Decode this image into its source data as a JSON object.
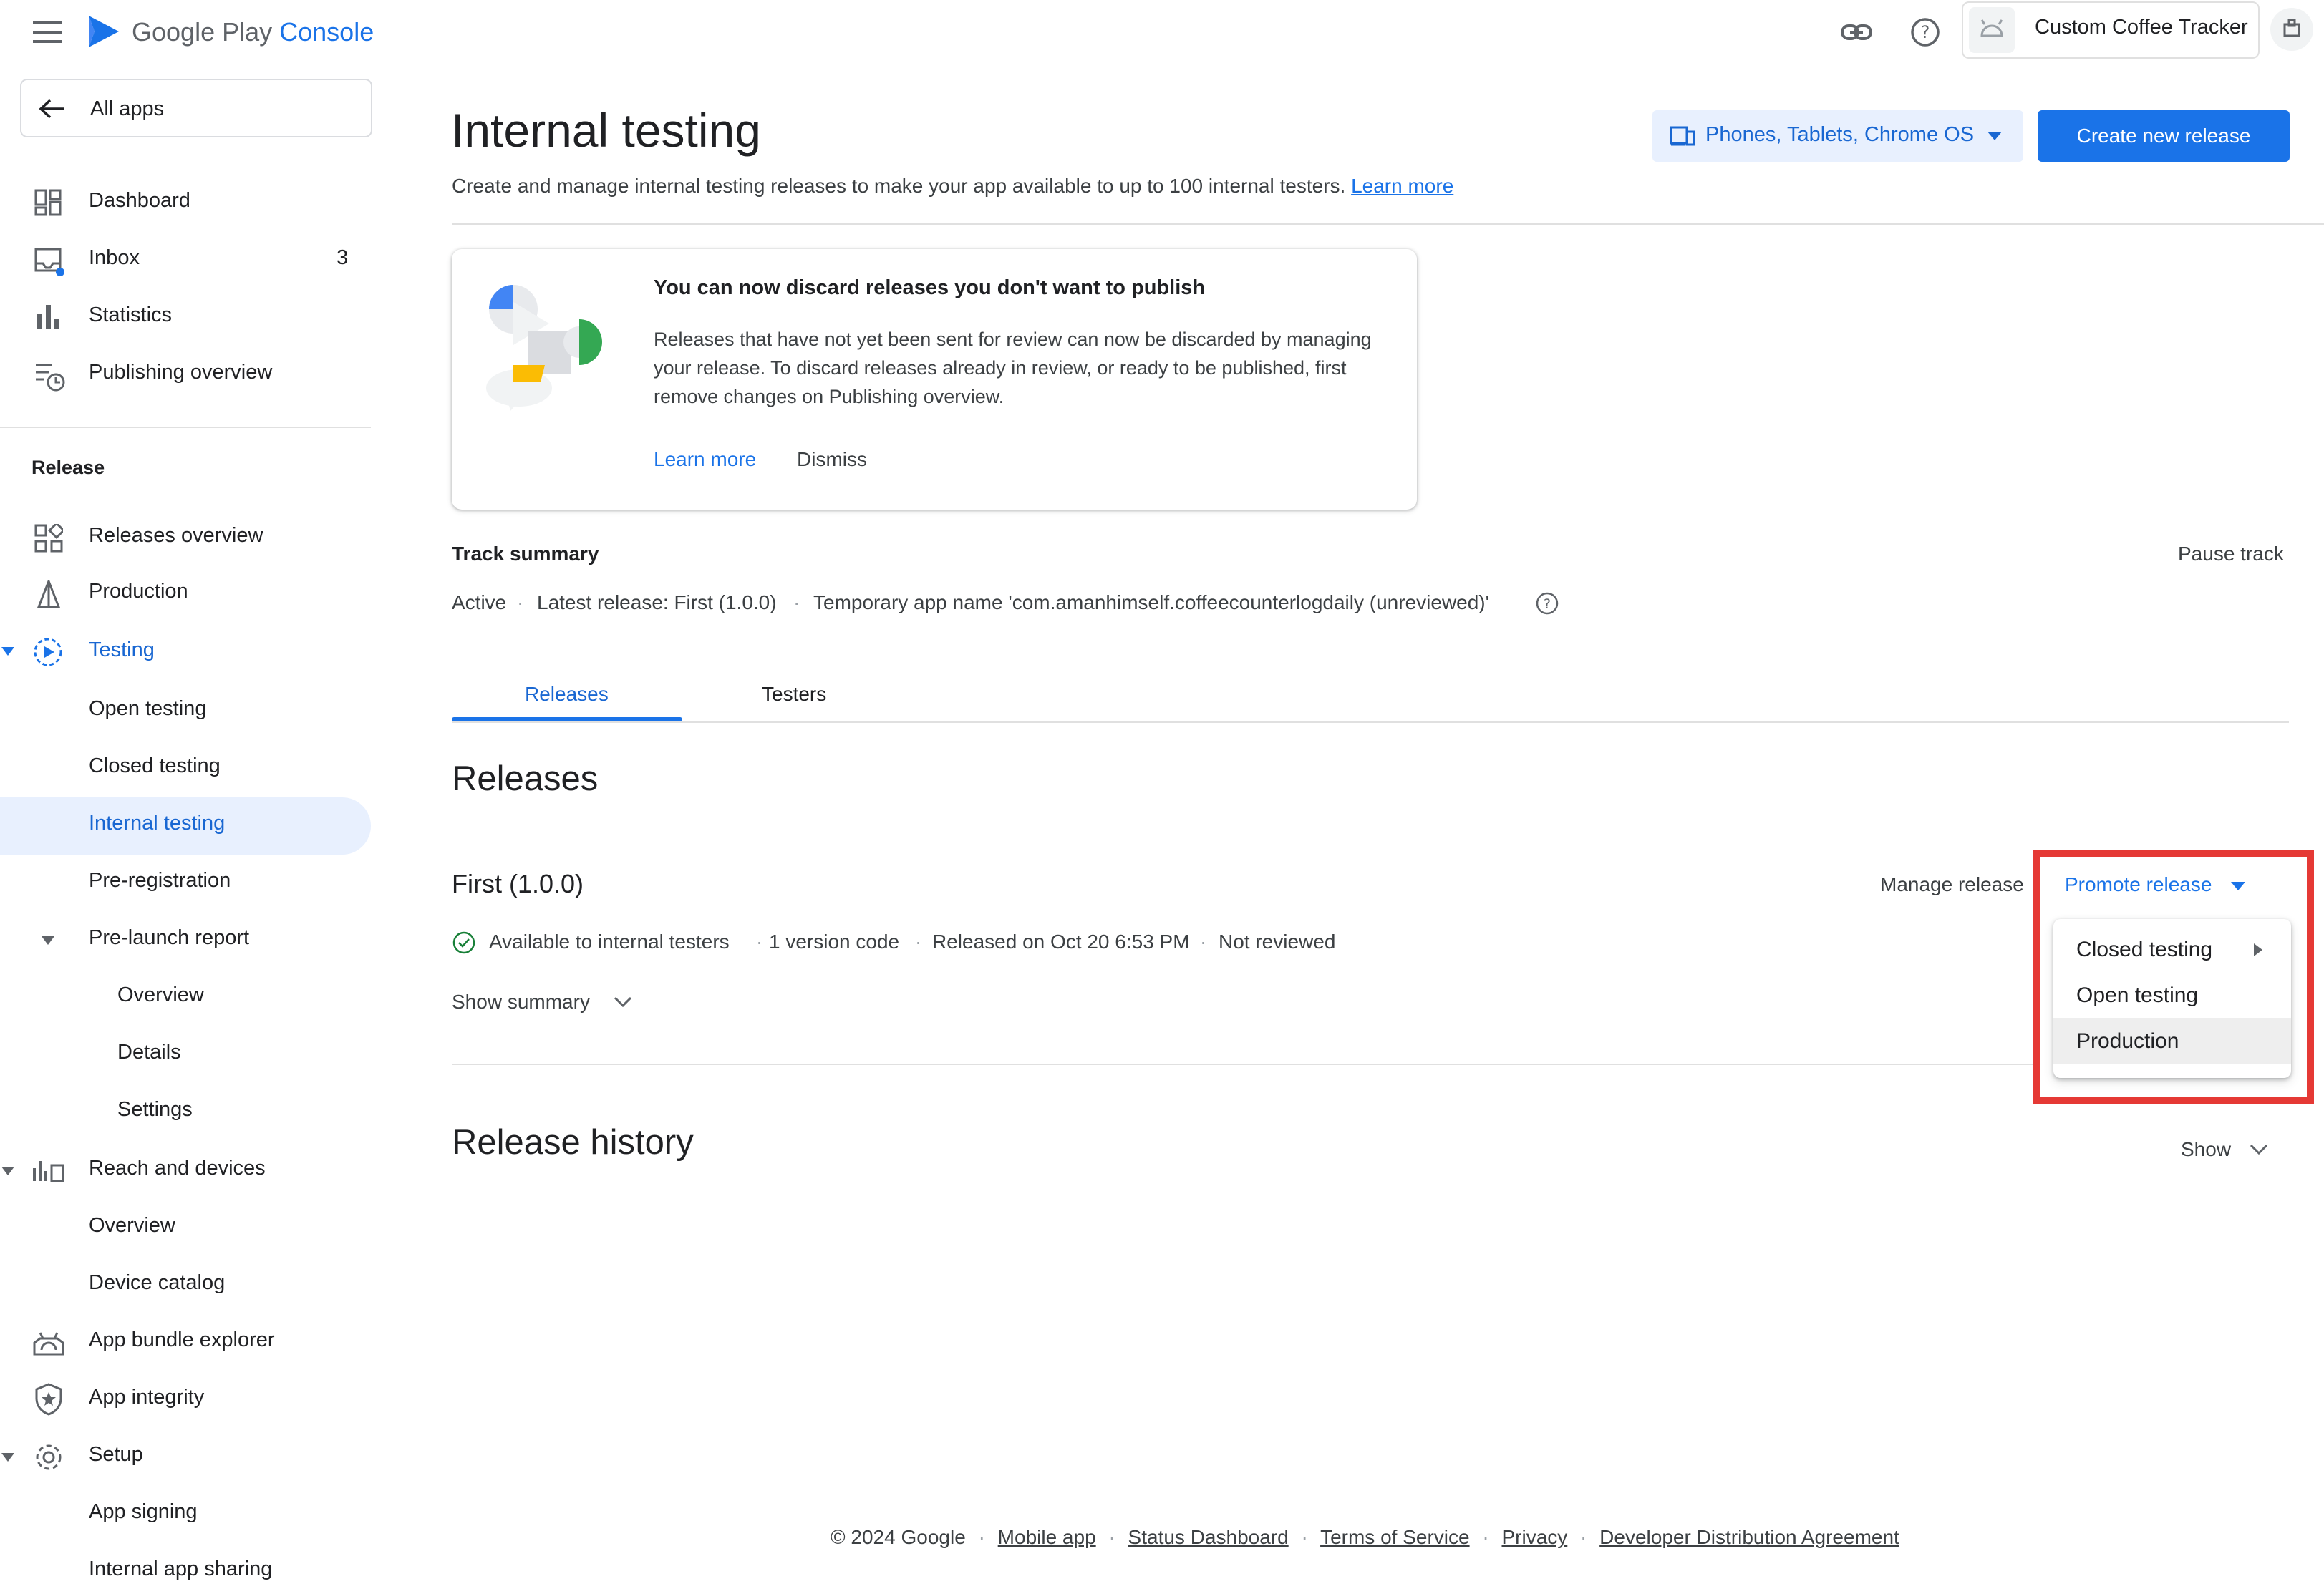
{
  "header": {
    "brand_google": "Google Play",
    "brand_console": "Console",
    "app_name": "Custom Coffee Tracker"
  },
  "sidebar": {
    "all_apps": "All apps",
    "items": {
      "dashboard": "Dashboard",
      "inbox": "Inbox",
      "inbox_count": "3",
      "statistics": "Statistics",
      "publishing_overview": "Publishing overview",
      "release_section": "Release",
      "releases_overview": "Releases overview",
      "production": "Production",
      "testing": "Testing",
      "open_testing": "Open testing",
      "closed_testing": "Closed testing",
      "internal_testing": "Internal testing",
      "pre_registration": "Pre-registration",
      "pre_launch_report": "Pre-launch report",
      "plr_overview": "Overview",
      "plr_details": "Details",
      "plr_settings": "Settings",
      "reach_and_devices": "Reach and devices",
      "rd_overview": "Overview",
      "device_catalog": "Device catalog",
      "app_bundle_explorer": "App bundle explorer",
      "app_integrity": "App integrity",
      "setup": "Setup",
      "app_signing": "App signing",
      "internal_app_sharing": "Internal app sharing"
    }
  },
  "main": {
    "title": "Internal testing",
    "subtitle": "Create and manage internal testing releases to make your app available to up to 100 internal testers.",
    "subtitle_link": "Learn more",
    "device_selector": "Phones, Tablets, Chrome OS",
    "create_button": "Create new release",
    "card": {
      "title": "You can now discard releases you don't want to publish",
      "body": "Releases that have not yet been sent for review can now be discarded by managing your release. To discard releases already in review, or ready to be published, first remove changes on Publishing overview.",
      "learn_more": "Learn more",
      "dismiss": "Dismiss"
    },
    "track_summary": {
      "heading": "Track summary",
      "pause": "Pause track",
      "status": "Active",
      "latest": "Latest release: First (1.0.0)",
      "temp_name": "Temporary app name 'com.amanhimself.coffeecounterlogdaily (unreviewed)'"
    },
    "tabs": [
      "Releases",
      "Testers"
    ],
    "releases_heading": "Releases",
    "release": {
      "name": "First (1.0.0)",
      "manage": "Manage release",
      "promote": "Promote release",
      "availability": "Available to internal testers",
      "version_codes": "1 version code",
      "released_on": "Released on Oct 20 6:53 PM",
      "review": "Not reviewed",
      "show_summary": "Show summary"
    },
    "promote_menu": [
      "Closed testing",
      "Open testing",
      "Production"
    ],
    "history_heading": "Release history",
    "history_show": "Show"
  },
  "footer": {
    "copyright": "© 2024 Google",
    "links": [
      "Mobile app",
      "Status Dashboard",
      "Terms of Service",
      "Privacy",
      "Developer Distribution Agreement"
    ]
  },
  "colors": {
    "accent": "#1a73e8",
    "active_bg": "#e8f0fe",
    "highlight_box": "#e53935",
    "success": "#188038"
  }
}
